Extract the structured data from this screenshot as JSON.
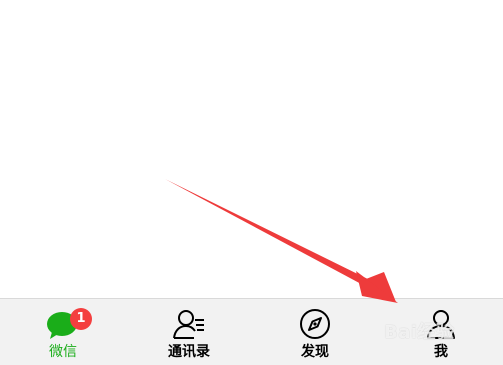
{
  "tabbar": {
    "tabs": [
      {
        "label": "微信",
        "icon": "chat-bubble-icon",
        "active": true,
        "badge": "1"
      },
      {
        "label": "通讯录",
        "icon": "contacts-icon",
        "active": false
      },
      {
        "label": "发现",
        "icon": "compass-icon",
        "active": false
      },
      {
        "label": "我",
        "icon": "person-icon",
        "active": false
      }
    ]
  },
  "colors": {
    "accent": "#1aad19",
    "badge": "#f43f3f",
    "tabbar_bg": "#f2f2f2",
    "arrow": "#ee3b3b"
  },
  "watermark": "Bai经验"
}
